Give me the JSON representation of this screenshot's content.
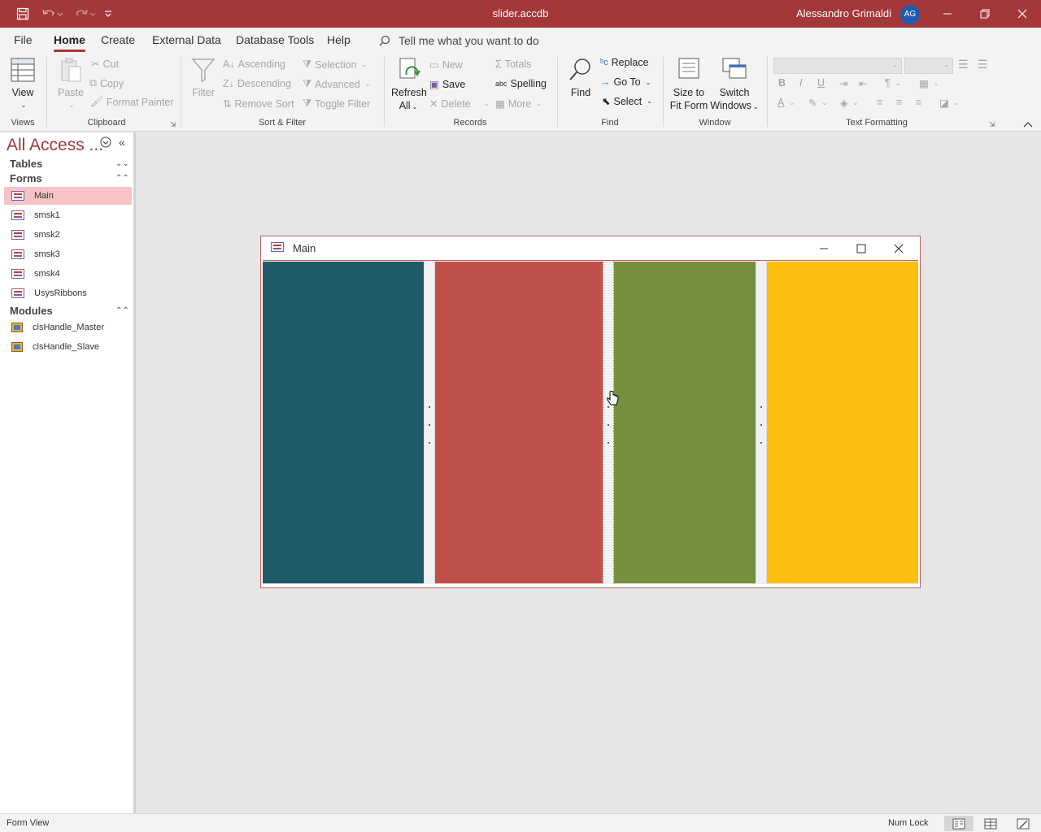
{
  "titlebar": {
    "document": "slider.accdb",
    "user": "Alessandro Grimaldi",
    "avatar_initials": "AG",
    "accent_color": "#a4373a"
  },
  "ribbon_tabs": [
    "File",
    "Home",
    "Create",
    "External Data",
    "Database Tools",
    "Help"
  ],
  "active_tab": "Home",
  "tell_me": "Tell me what you want to do",
  "ribbon": {
    "views": {
      "view_label": "View",
      "group": "Views"
    },
    "clipboard": {
      "paste": "Paste",
      "cut": "Cut",
      "copy": "Copy",
      "format_painter": "Format Painter",
      "group": "Clipboard"
    },
    "sort_filter": {
      "filter": "Filter",
      "ascending": "Ascending",
      "descending": "Descending",
      "remove_sort": "Remove Sort",
      "selection": "Selection",
      "advanced": "Advanced",
      "toggle_filter": "Toggle Filter",
      "group": "Sort & Filter"
    },
    "records": {
      "refresh_line1": "Refresh",
      "refresh_line2": "All",
      "new": "New",
      "save": "Save",
      "delete": "Delete",
      "totals": "Totals",
      "spelling": "Spelling",
      "more": "More",
      "group": "Records"
    },
    "find": {
      "find": "Find",
      "replace": "Replace",
      "go_to": "Go To",
      "select": "Select",
      "group": "Find"
    },
    "window": {
      "size_line1": "Size to",
      "size_line2": "Fit Form",
      "switch_line1": "Switch",
      "switch_line2": "Windows",
      "group": "Window"
    },
    "text_formatting": {
      "bold": "B",
      "italic": "I",
      "underline": "U",
      "group": "Text Formatting"
    }
  },
  "nav": {
    "title": "All Access ...",
    "categories": {
      "tables": "Tables",
      "forms": "Forms",
      "modules": "Modules"
    },
    "forms": [
      "Main",
      "smsk1",
      "smsk2",
      "smsk3",
      "smsk4",
      "UsysRibbons"
    ],
    "selected_form": "Main",
    "modules": [
      "clsHandle_Master",
      "clsHandle_Slave"
    ]
  },
  "form_window": {
    "title": "Main",
    "panel_colors": [
      "#1f5a68",
      "#c0504a",
      "#76903f",
      "#fec010"
    ]
  },
  "statusbar": {
    "mode": "Form View",
    "num_lock": "Num Lock"
  }
}
